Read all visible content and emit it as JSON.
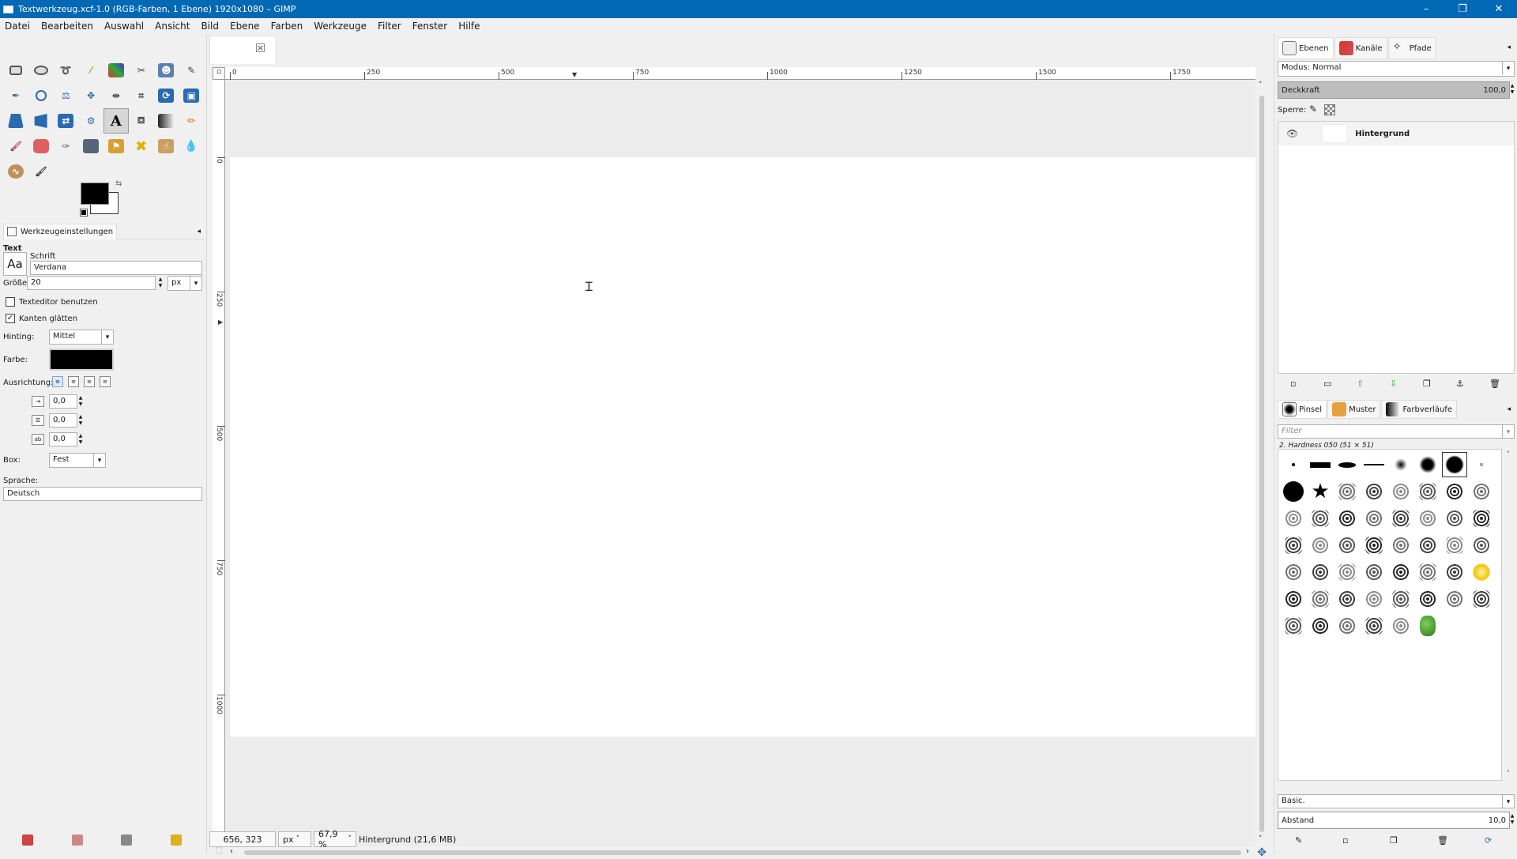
{
  "window": {
    "title": "Textwerkzeug.xcf-1.0 (RGB-Farben, 1 Ebene) 1920x1080 – GIMP",
    "controls": {
      "minimize": "–",
      "maximize": "❐",
      "close": "✕"
    }
  },
  "menu": [
    "Datei",
    "Bearbeiten",
    "Auswahl",
    "Ansicht",
    "Bild",
    "Ebene",
    "Farben",
    "Werkzeuge",
    "Filter",
    "Fenster",
    "Hilfe"
  ],
  "colors": {
    "titlebar": "#0068b5",
    "foreground": "#000000",
    "background": "#ffffff",
    "layer_panel_opacity_bar": "#bdbdbd"
  },
  "toolbox": {
    "rows": [
      [
        "rect-select",
        "ellipse-select",
        "free-select",
        "fuzzy-select",
        "by-color-select",
        "scissors-select",
        "foreground-select",
        "paths"
      ],
      [
        "color-picker",
        "zoom",
        "measure",
        "move",
        "align",
        "crop",
        "unified-transform",
        "cage-transform"
      ],
      [
        "perspective",
        "3d-transform",
        "flip",
        "handle-transform",
        "text",
        "bucket-fill",
        "gradient",
        "pencil"
      ],
      [
        "paintbrush",
        "eraser",
        "airbrush",
        "ink",
        "clone",
        "heal",
        "smudge-convolve",
        "dodge-burn"
      ],
      [
        "warp",
        "paint-select"
      ]
    ]
  },
  "tool_options": {
    "tab_label": "Werkzeugeinstellungen",
    "section_title": "Text",
    "font_label": "Schrift",
    "font_preview": "Aa",
    "font_value": "Verdana",
    "size_label": "Größe:",
    "size_value": "20",
    "size_unit": "px",
    "use_editor_label": "Texteditor benutzen",
    "use_editor_checked": false,
    "antialias_label": "Kanten glätten",
    "antialias_checked": true,
    "hinting_label": "Hinting:",
    "hinting_value": "Mittel",
    "color_label": "Farbe:",
    "color_value": "#000000",
    "justify_label": "Ausrichtung:",
    "indent_value": "0,0",
    "line_spacing_value": "0,0",
    "letter_spacing_value": "0,0",
    "box_label": "Box:",
    "box_value": "Fest",
    "language_label": "Sprache:",
    "language_value": "Deutsch"
  },
  "canvas": {
    "ruler_top": [
      "0",
      "250",
      "500",
      "750",
      "1000",
      "1250",
      "1500",
      "1750"
    ],
    "ruler_left": [
      "0",
      "250",
      "500",
      "750",
      "1000"
    ],
    "pointer_icon": "i-beam-cursor-icon"
  },
  "status": {
    "coords": "656, 323",
    "unit": "px",
    "zoom": "67,9 %",
    "info": "Hintergrund (21,6 MB)"
  },
  "layers_panel": {
    "tabs": [
      "Ebenen",
      "Kanäle",
      "Pfade"
    ],
    "mode_label": "Modus: Normal",
    "opacity_label": "Deckkraft",
    "opacity_value": "100,0",
    "lock_label": "Sperre:",
    "layers": [
      {
        "name": "Hintergrund",
        "visible": true
      }
    ]
  },
  "brushes_panel": {
    "tabs": [
      "Pinsel",
      "Muster",
      "Farbverläufe"
    ],
    "filter_placeholder": "Filter",
    "selected_brush": "2. Hardness 050 (51 × 51)",
    "preset": "Basic.",
    "spacing_label": "Abstand",
    "spacing_value": "10,0"
  }
}
